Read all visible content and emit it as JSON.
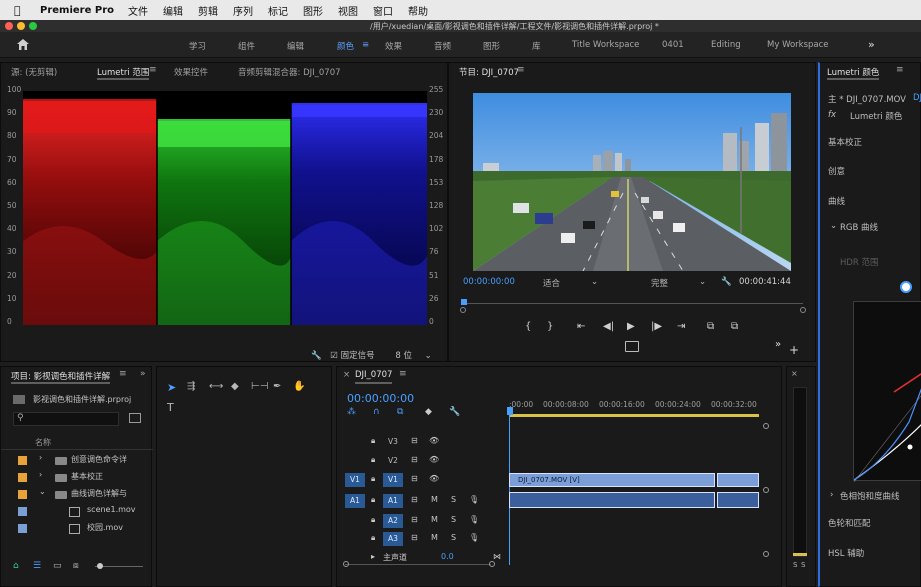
{
  "menubar": {
    "app_name": "Premiere Pro",
    "items": [
      "文件",
      "编辑",
      "剪辑",
      "序列",
      "标记",
      "图形",
      "视图",
      "窗口",
      "帮助"
    ]
  },
  "titlebar": {
    "title": "/用户/xuedian/桌面/影视调色和插件详解/工程文件/影视调色和插件详解.prproj *"
  },
  "workspaces": {
    "items": [
      "学习",
      "组件",
      "编辑",
      "颜色",
      "效果",
      "音频",
      "图形",
      "库",
      "Title Workspace",
      "0401",
      "Editing",
      "My Workspace"
    ],
    "active": "颜色",
    "more": "»"
  },
  "scope_panel": {
    "tabs": [
      "源: (无剪辑)",
      "Lumetri 范围",
      "效果控件",
      "音频剪辑混合器: DJI_0707"
    ],
    "active_tab": "Lumetri 范围",
    "left_ticks": [
      "100",
      "90",
      "80",
      "70",
      "60",
      "50",
      "40",
      "30",
      "20",
      "10",
      "0"
    ],
    "right_ticks": [
      "255",
      "230",
      "204",
      "178",
      "153",
      "128",
      "102",
      "76",
      "51",
      "26",
      "0"
    ],
    "clamp_label": "固定信号",
    "bit_depth": "8 位"
  },
  "program_monitor": {
    "title": "节目: DJI_0707",
    "timecode_current": "00:00:00:00",
    "fit": "适合",
    "quality": "完整",
    "timecode_duration": "00:00:41:44",
    "transport_glyphs": [
      "{",
      "}",
      "⇤",
      "◀|",
      "▶",
      "|▶",
      "⇥",
      "⧉",
      "⧉"
    ]
  },
  "lumetri_color": {
    "title": "Lumetri 颜色",
    "clip": "主 * DJI_0707.MOV",
    "clip_right": "DJ",
    "fx_label": "fx",
    "effect": "Lumetri 颜色",
    "sections": [
      "基本校正",
      "创意",
      "曲线",
      "RGB 曲线",
      "HDR 范围",
      "色相饱和度曲线",
      "色轮和匹配",
      "HSL 辅助"
    ]
  },
  "project_panel": {
    "title": "项目: 影视调色和插件详解",
    "file": "影视调色和插件详解.prproj",
    "column_header": "名称",
    "items": [
      {
        "name": "创意调色命令详",
        "type": "folder",
        "color": "#e8a23a"
      },
      {
        "name": "基本校正",
        "type": "folder",
        "color": "#e8a23a"
      },
      {
        "name": "曲线调色详解与",
        "type": "folder",
        "color": "#e8a23a"
      },
      {
        "name": "scene1.mov",
        "type": "clip",
        "color": "#7a9fd4"
      },
      {
        "name": "校园.mov",
        "type": "clip",
        "color": "#7a9fd4"
      }
    ]
  },
  "timeline": {
    "sequence_name": "DJI_0707",
    "timecode": "00:00:00:00",
    "ruler_labels": [
      ":00:00",
      "00:00:08:00",
      "00:00:16:00",
      "00:00:24:00",
      "00:00:32:00"
    ],
    "tracks": [
      "V3",
      "V2",
      "V1",
      "A1",
      "A2",
      "A3"
    ],
    "source_patch": [
      "V1",
      "A1"
    ],
    "clip_label": "DJI_0707.MOV [V]",
    "master_label": "主声道",
    "master_value": "0.0",
    "audio_track_letters": [
      "M",
      "S"
    ]
  },
  "meter": {
    "labels": [
      "S",
      "S"
    ]
  }
}
